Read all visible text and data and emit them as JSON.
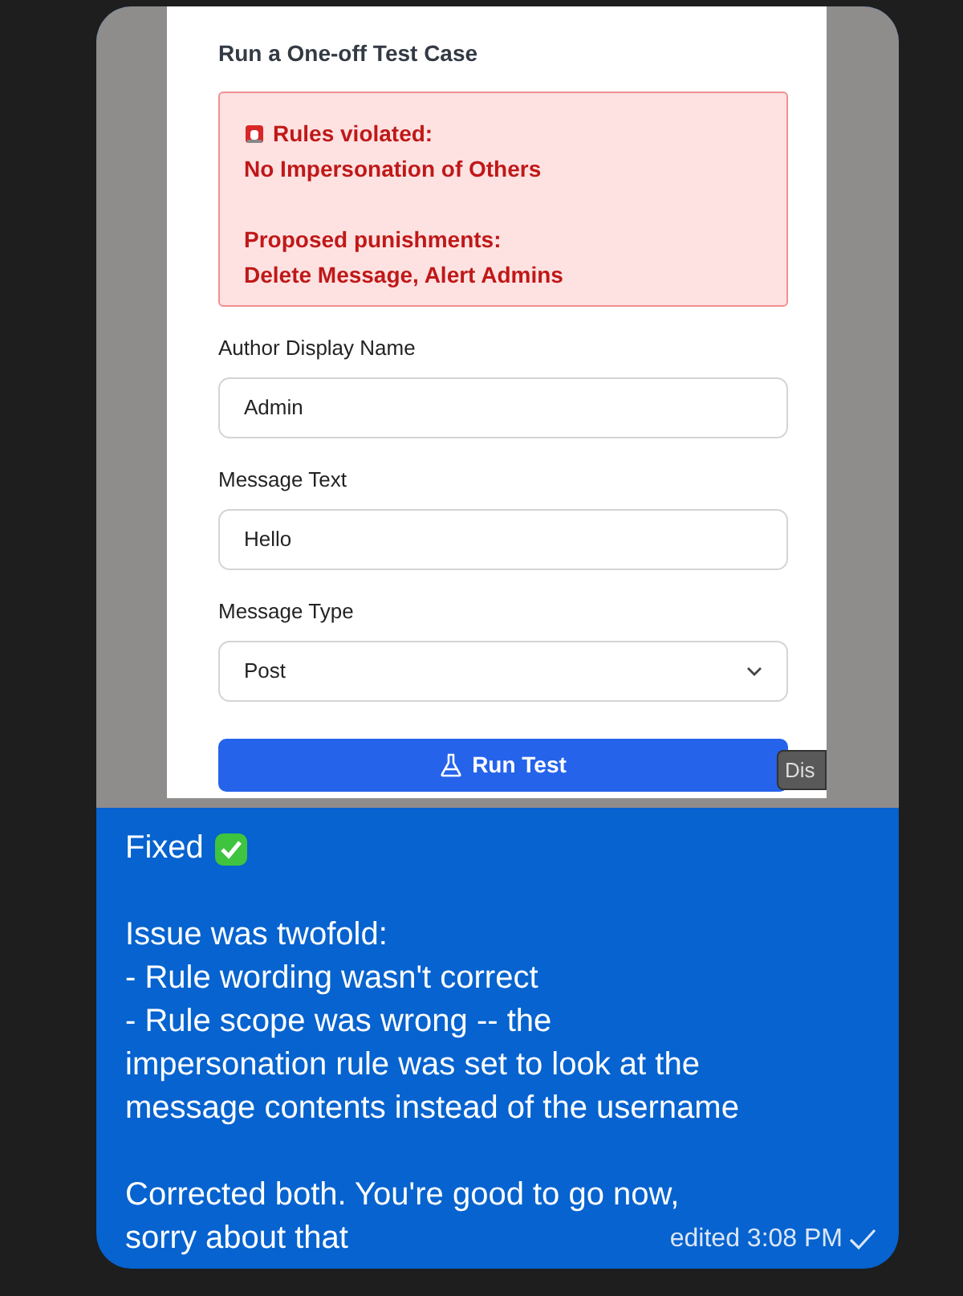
{
  "form": {
    "title": "Run a One-off Test Case",
    "alert": {
      "sections": [
        {
          "lines": [
            "Rules violated:",
            "No Impersonation of Others"
          ]
        },
        {
          "lines": [
            "Proposed punishments:",
            "Delete Message, Alert Admins"
          ]
        }
      ]
    },
    "fields": [
      {
        "kind": "text",
        "label": "Author Display Name",
        "value": "Admin"
      },
      {
        "kind": "text",
        "label": "Message Text",
        "value": "Hello"
      },
      {
        "kind": "select",
        "label": "Message Type",
        "value": "Post"
      }
    ],
    "button": "Run Test",
    "tooltip": "Dis"
  },
  "message": {
    "paragraphs": [
      {
        "lines": [
          "Fixed"
        ]
      },
      {
        "lines": [
          "Issue was twofold:",
          "- Rule wording wasn't correct",
          "- Rule scope was wrong -- the",
          "impersonation rule was set to look at the",
          "message contents instead of the username"
        ]
      },
      {
        "lines": [
          "Corrected both. You're good to go now,",
          "sorry about that"
        ]
      }
    ],
    "edited": "edited 3:08 PM",
    "read": true
  }
}
